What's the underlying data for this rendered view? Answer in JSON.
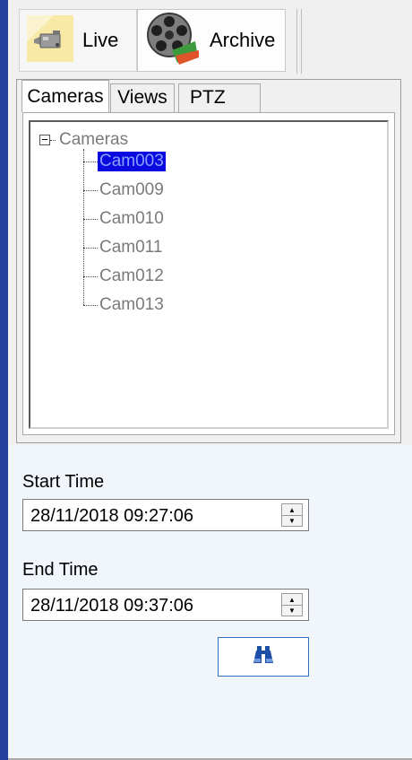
{
  "toolbar": {
    "live_label": "Live",
    "archive_label": "Archive"
  },
  "tabs": [
    {
      "label": "Cameras",
      "active": true
    },
    {
      "label": "Views",
      "active": false
    },
    {
      "label": "PTZ",
      "active": false
    }
  ],
  "tree": {
    "root_label": "Cameras",
    "expanded": true,
    "items": [
      {
        "label": "Cam003",
        "selected": true
      },
      {
        "label": "Cam009",
        "selected": false
      },
      {
        "label": "Cam010",
        "selected": false
      },
      {
        "label": "Cam011",
        "selected": false
      },
      {
        "label": "Cam012",
        "selected": false
      },
      {
        "label": "Cam013",
        "selected": false
      }
    ]
  },
  "time": {
    "start_label": "Start Time",
    "start_value": "28/11/2018 09:27:06",
    "end_label": "End Time",
    "end_value": "28/11/2018 09:37:06"
  },
  "search_button": {
    "icon": "binoculars-icon"
  },
  "colors": {
    "accent_bar": "#24419b",
    "selection": "#0a0ae0",
    "lower_bg": "#f1f6fc",
    "button_border": "#2f6fc4"
  }
}
